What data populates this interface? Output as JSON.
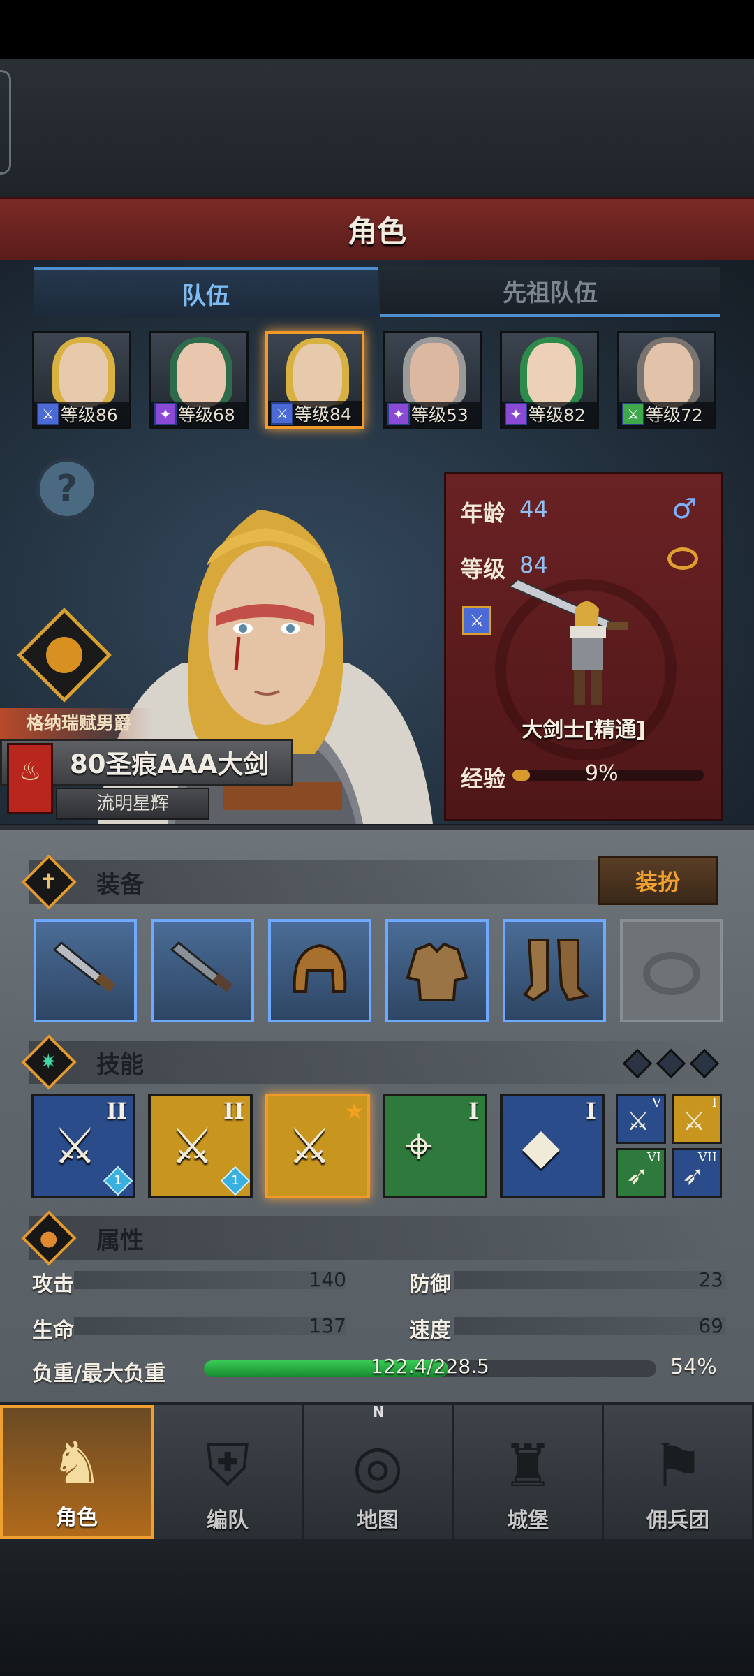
{
  "title": "角色",
  "tabs": {
    "team": "队伍",
    "ancestor": "先祖队伍"
  },
  "heroes": [
    {
      "level": "等级86",
      "class_color": "#4b6ad6",
      "hair": "#d9b042",
      "skin": "#e7c9ac"
    },
    {
      "level": "等级68",
      "class_color": "#8a4ad6",
      "hair": "#2e6b4a",
      "skin": "#e9c7ae"
    },
    {
      "level": "等级84",
      "class_color": "#4b6ad6",
      "hair": "#d9b042",
      "skin": "#e7c9ac"
    },
    {
      "level": "等级53",
      "class_color": "#8a4ad6",
      "hair": "#9a9a9a",
      "skin": "#dcb8a0"
    },
    {
      "level": "等级82",
      "class_color": "#8a4ad6",
      "hair": "#2e8a4a",
      "skin": "#ecd0b8"
    },
    {
      "level": "等级72",
      "class_color": "#3fa84a",
      "hair": "#7a7470",
      "skin": "#e2c2a8"
    }
  ],
  "info": {
    "age_label": "年龄",
    "age": "44",
    "level_label": "等级",
    "level": "84",
    "class_name": "大剑士[精通]",
    "exp_label": "经验",
    "exp_pct": "9%",
    "exp_fraction": 0.09
  },
  "hero": {
    "noble_title": "格纳瑞赋男爵",
    "weapon_name": "80圣痕AAA大剑",
    "sub_title": "流明星辉"
  },
  "equipment": {
    "header": "装备",
    "dress_button": "装扮"
  },
  "skills": {
    "header": "技能",
    "main": [
      {
        "rank": "II",
        "bg": "#2a4c8a",
        "gem": "1"
      },
      {
        "rank": "II",
        "bg": "#c8961e",
        "gem": "1"
      },
      {
        "rank": "",
        "bg": "#c8961e",
        "gem": ""
      },
      {
        "rank": "I",
        "bg": "#2e7a3c",
        "gem": ""
      },
      {
        "rank": "I",
        "bg": "#2a4c8a",
        "gem": ""
      }
    ],
    "mini": [
      {
        "rank": "V",
        "bg": "#2a4c8a"
      },
      {
        "rank": "I",
        "bg": "#c8961e"
      },
      {
        "rank": "VI",
        "bg": "#2e7a3c"
      },
      {
        "rank": "VII",
        "bg": "#2a4c8a"
      }
    ]
  },
  "attributes": {
    "header": "属性",
    "attack_label": "攻击",
    "attack": "140",
    "defense_label": "防御",
    "defense": "23",
    "hp_label": "生命",
    "hp": "137",
    "speed_label": "速度",
    "speed": "69",
    "load_label": "负重/最大负重",
    "load_text": "122.4/228.5",
    "load_pct": "54%",
    "load_fraction": 0.54
  },
  "nav": [
    {
      "label": "角色",
      "icon": "knight-icon"
    },
    {
      "label": "编队",
      "icon": "helmet-icon"
    },
    {
      "label": "地图",
      "icon": "compass-map-icon"
    },
    {
      "label": "城堡",
      "icon": "castle-icon"
    },
    {
      "label": "佣兵团",
      "icon": "mercenary-icon"
    }
  ],
  "compass_n": "N"
}
